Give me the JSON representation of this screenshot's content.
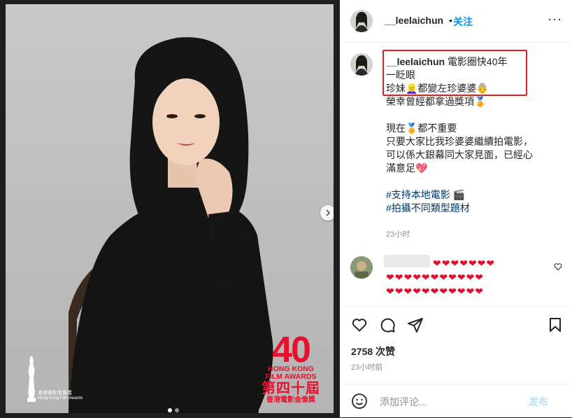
{
  "photo": {
    "award_logo": {
      "number": "40",
      "english": "HONG KONG FILM AWARDS",
      "chinese_edition": "第四十屆",
      "chinese_name": "香港電影金像獎"
    },
    "trophy_logo": {
      "chinese": "香港電影金像獎",
      "english": "Hong Kong Film Awards"
    },
    "carousel_count": 2
  },
  "header": {
    "username": "__leelaichun",
    "separator": "•",
    "follow_label": "关注",
    "more_label": "···"
  },
  "caption": {
    "username": "__leelaichun",
    "first_line": "電影圈快40年",
    "lines": [
      "一眨眼",
      "珍妹👱‍♀️都變左珍婆婆👵",
      "榮幸曾經都拿過獎項🏅",
      "",
      "現在🏅都不重要",
      "只要大家比我珍婆婆繼續拍電影，",
      "可以係大銀幕同大家見面，已經心",
      "滿意足💖",
      ""
    ],
    "hashtags": [
      "#支持本地電影 🎬",
      "#拍攝不同類型題材"
    ],
    "time": "23小时"
  },
  "comment": {
    "hearts_line1": "❤❤❤❤❤❤❤",
    "hearts_line2": "❤❤❤❤❤❤❤❤❤❤❤",
    "hearts_line3": "❤❤❤❤❤❤❤❤❤❤❤"
  },
  "stats": {
    "likes": "2758 次赞",
    "time": "23小时前"
  },
  "composer": {
    "placeholder": "添加评论...",
    "post_label": "发布"
  },
  "colors": {
    "accent": "#0095f6",
    "highlight": "#e02020",
    "heart": "#e0102c",
    "award_red": "#e8102c"
  }
}
